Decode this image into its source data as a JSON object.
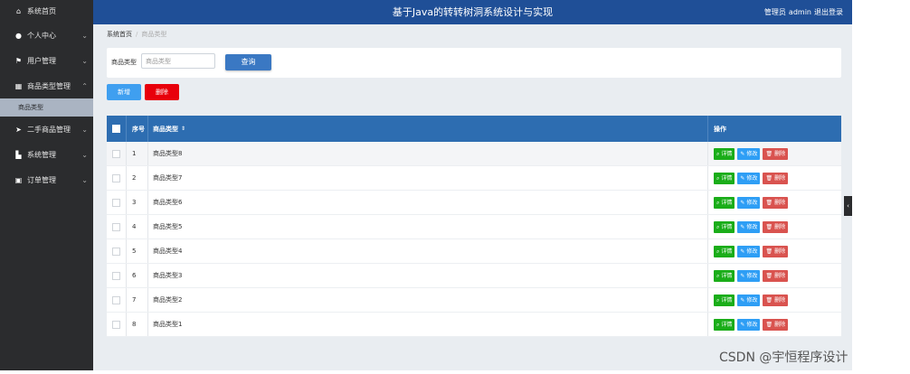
{
  "sidebar": {
    "items": [
      {
        "label": "系统首页",
        "icon": "home-icon",
        "glyph": "⌂",
        "chevron": ""
      },
      {
        "label": "个人中心",
        "icon": "user-icon",
        "glyph": "●",
        "chevron": "⌄"
      },
      {
        "label": "用户管理",
        "icon": "flag-icon",
        "glyph": "⚑",
        "chevron": "⌄"
      },
      {
        "label": "商品类型管理",
        "icon": "table-icon",
        "glyph": "▦",
        "chevron": "⌃"
      },
      {
        "label": "二手商品管理",
        "icon": "send-icon",
        "glyph": "➤",
        "chevron": "⌄"
      },
      {
        "label": "系统管理",
        "icon": "chart-icon",
        "glyph": "▙",
        "chevron": "⌄"
      },
      {
        "label": "订单管理",
        "icon": "clipboard-icon",
        "glyph": "▣",
        "chevron": "⌄"
      }
    ],
    "sub_item": "商品类型"
  },
  "header": {
    "title": "基于Java的转转树洞系统设计与实现",
    "role": "管理员",
    "username": "admin",
    "logout": "退出登录"
  },
  "breadcrumb": {
    "home": "系统首页",
    "separator": "/",
    "current": "商品类型"
  },
  "search": {
    "label": "商品类型",
    "placeholder": "商品类型",
    "button": "查询"
  },
  "actions": {
    "add": "新增",
    "delete": "删除"
  },
  "table": {
    "columns": {
      "no": "序号",
      "name": "商品类型",
      "sort_glyph": "⇕",
      "ops": "操作"
    },
    "rows": [
      {
        "no": "1",
        "name": "商品类型8"
      },
      {
        "no": "2",
        "name": "商品类型7"
      },
      {
        "no": "3",
        "name": "商品类型6"
      },
      {
        "no": "4",
        "name": "商品类型5"
      },
      {
        "no": "5",
        "name": "商品类型4"
      },
      {
        "no": "6",
        "name": "商品类型3"
      },
      {
        "no": "7",
        "name": "商品类型2"
      },
      {
        "no": "8",
        "name": "商品类型1"
      }
    ],
    "row_ops": {
      "detail": "详情",
      "edit": "修改",
      "delete": "删除"
    }
  },
  "watermark": "CSDN @宇恒程序设计",
  "colors": {
    "sidebar_bg": "#2b2c2e",
    "header_bg": "#1f4f97",
    "table_head_bg": "#2d6db1",
    "detail_btn": "#1aad19",
    "edit_btn": "#2e9ef5",
    "delete_btn": "#d9534f",
    "danger_btn": "#e8000b",
    "primary_btn": "#3a78c3",
    "add_btn": "#3f9ff0"
  }
}
